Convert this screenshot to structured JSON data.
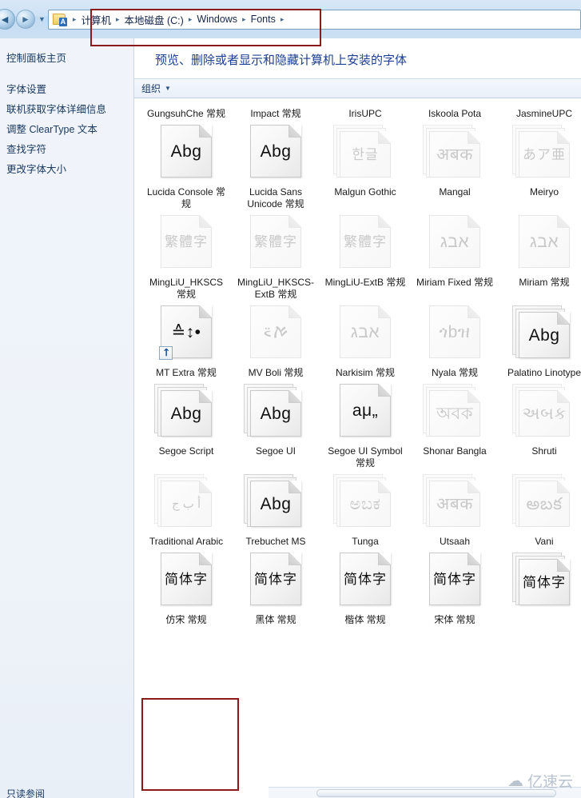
{
  "window": {
    "nav": {
      "back_icon": "back-arrow-icon",
      "forward_icon": "forward-arrow-icon",
      "history_dropdown_icon": "chevron-down-icon",
      "folder_icon": "fonts-folder-icon",
      "breadcrumbs": [
        "计算机",
        "本地磁盘 (C:)",
        "Windows",
        "Fonts"
      ],
      "separator": "▸"
    }
  },
  "sidebar": {
    "home_link": "控制面板主页",
    "items": [
      "字体设置",
      "联机获取字体详细信息",
      "调整 ClearType 文本",
      "查找字符",
      "更改字体大小"
    ],
    "bottom_text": "只读参阅"
  },
  "main": {
    "heading": "预览、删除或者显示和隐藏计算机上安装的字体",
    "toolbar": {
      "organize_label": "组织",
      "caret_icon": "caret-down-icon"
    }
  },
  "grid": {
    "top_partial_row": [
      {
        "name": "GungsuhChe 常规"
      },
      {
        "name": "Impact 常规"
      },
      {
        "name": "IrisUPC"
      },
      {
        "name": "Iskoola Pota"
      },
      {
        "name": "JasmineUPC"
      }
    ],
    "rows": [
      [
        {
          "name": "Lucida Console 常规",
          "glyph": "Abg",
          "style": "single",
          "hidden": false
        },
        {
          "name": "Lucida Sans Unicode 常规",
          "glyph": "Abg",
          "style": "single",
          "hidden": false
        },
        {
          "name": "Malgun Gothic",
          "glyph": "한글",
          "style": "stack",
          "hidden": true
        },
        {
          "name": "Mangal",
          "glyph": "अबक",
          "style": "stack",
          "hidden": true
        },
        {
          "name": "Meiryo",
          "glyph": "あア亜",
          "style": "stack",
          "hidden": true
        }
      ],
      [
        {
          "name": "MingLiU_HKSCS 常规",
          "glyph": "繁體字",
          "style": "single",
          "hidden": true
        },
        {
          "name": "MingLiU_HKSCS-ExtB 常规",
          "glyph": "繁體字",
          "style": "single",
          "hidden": true
        },
        {
          "name": "MingLiU-ExtB 常规",
          "glyph": "繁體字",
          "style": "single",
          "hidden": true
        },
        {
          "name": "Miriam Fixed 常规",
          "glyph": "אבג",
          "style": "single",
          "hidden": true
        },
        {
          "name": "Miriam 常规",
          "glyph": "אבג",
          "style": "single",
          "hidden": true
        }
      ],
      [
        {
          "name": "MT Extra 常规",
          "glyph": "≙↕•",
          "style": "single",
          "hidden": false,
          "shortcut": true
        },
        {
          "name": "MV Boli 常规",
          "glyph": "ࠀ࠵",
          "style": "single",
          "hidden": true
        },
        {
          "name": "Narkisim 常规",
          "glyph": "אבג",
          "style": "single",
          "hidden": true
        },
        {
          "name": "Nyala 常规",
          "glyph": "ጎbዝ",
          "style": "single",
          "hidden": true
        },
        {
          "name": "Palatino Linotype",
          "glyph": "Abg",
          "style": "stack",
          "hidden": false
        }
      ],
      [
        {
          "name": "Segoe Script",
          "glyph": "Abg",
          "style": "stack",
          "hidden": false
        },
        {
          "name": "Segoe UI",
          "glyph": "Abg",
          "style": "stack",
          "hidden": false
        },
        {
          "name": "Segoe UI Symbol 常规",
          "glyph": "aμ„",
          "style": "single",
          "hidden": false
        },
        {
          "name": "Shonar Bangla",
          "glyph": "অবক",
          "style": "stack",
          "hidden": true
        },
        {
          "name": "Shruti",
          "glyph": "અબક",
          "style": "stack",
          "hidden": true
        }
      ],
      [
        {
          "name": "Traditional Arabic",
          "glyph": "أ ب ج",
          "style": "stack",
          "hidden": true
        },
        {
          "name": "Trebuchet MS",
          "glyph": "Abg",
          "style": "stack",
          "hidden": false
        },
        {
          "name": "Tunga",
          "glyph": "ಅಬಕ",
          "style": "stack",
          "hidden": true
        },
        {
          "name": "Utsaah",
          "glyph": "अबक",
          "style": "stack",
          "hidden": true
        },
        {
          "name": "Vani",
          "glyph": "అబక",
          "style": "stack",
          "hidden": true
        }
      ],
      [
        {
          "name": "仿宋 常规",
          "glyph": "简体字",
          "style": "single",
          "hidden": false,
          "selected": true
        },
        {
          "name": "黑体 常规",
          "glyph": "简体字",
          "style": "single",
          "hidden": false
        },
        {
          "name": "楷体 常规",
          "glyph": "简体字",
          "style": "single",
          "hidden": false
        },
        {
          "name": "宋体 常规",
          "glyph": "简体字",
          "style": "single",
          "hidden": false
        },
        {
          "name": "",
          "glyph": "简体字",
          "style": "stack",
          "hidden": false
        }
      ]
    ]
  },
  "annotations": {
    "color": "#8b1a1a",
    "boxes": [
      {
        "target": "address-bar-breadcrumbs"
      },
      {
        "target": "fangsong-font-item"
      }
    ]
  },
  "watermark": {
    "text": "亿速云",
    "icon": "cloud-icon"
  }
}
